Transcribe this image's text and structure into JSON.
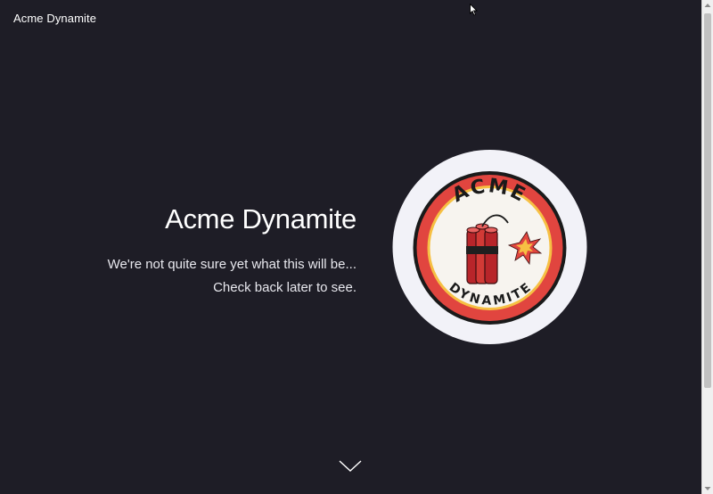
{
  "header": {
    "brand": "Acme Dynamite"
  },
  "hero": {
    "title": "Acme Dynamite",
    "line1": "We're not quite sure yet what this will be...",
    "line2": "Check back later to see."
  },
  "logo": {
    "top_text": "ACME",
    "bottom_text": "DYNAMITE"
  },
  "icons": {
    "scroll_down": "chevron-down-icon",
    "cursor": "mouse-pointer-icon"
  },
  "colors": {
    "background": "#1e1d26",
    "text": "#ffffff",
    "logo_bg": "#f2f2f8",
    "logo_red": "#e1453f",
    "logo_yellow": "#f6c043",
    "logo_dark": "#222222"
  }
}
